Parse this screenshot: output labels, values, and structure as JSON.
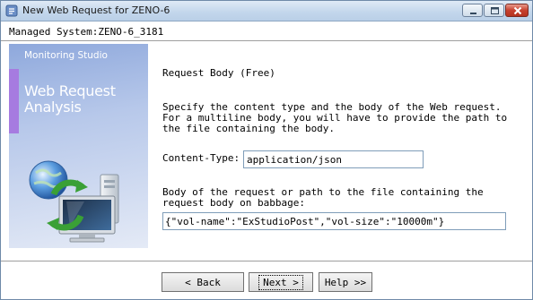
{
  "window": {
    "title": "New Web Request for ZENO-6",
    "controls": {
      "minimize_icon": "minimize-icon",
      "maximize_icon": "maximize-icon",
      "close_icon": "close-icon"
    }
  },
  "header": {
    "managed_system": "Managed System:ZENO-6_3181"
  },
  "banner": {
    "brand": "Monitoring Studio",
    "title_line1": "Web Request",
    "title_line2": "Analysis",
    "art_icon": "globe-computer-sync-icon",
    "accent_color": "#a67be0"
  },
  "content": {
    "section_title": "Request Body (Free)",
    "description_lines": [
      "Specify the content type and the body of the Web request.",
      "For a multiline body, you will have to provide the path to",
      "the file containing the body."
    ],
    "content_type": {
      "label": "Content-Type:",
      "value": "application/json"
    },
    "body": {
      "label_lines": [
        "Body of the request or path to the file containing the",
        "request body on babbage:"
      ],
      "value": "{\"vol-name\":\"ExStudioPost\",\"vol-size\":\"10000m\"}"
    }
  },
  "buttons": {
    "back": "< Back",
    "next": "Next >",
    "help": "Help >>"
  }
}
